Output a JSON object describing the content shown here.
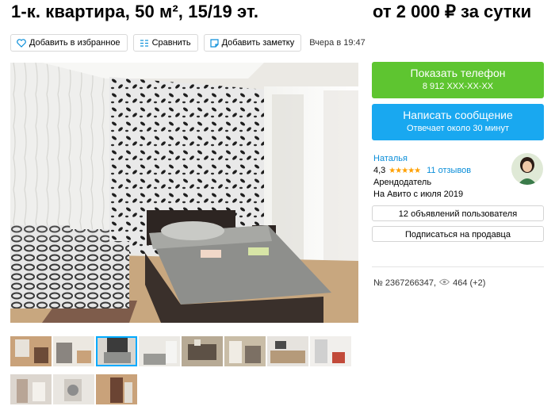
{
  "listing": {
    "title": "1-к. квартира, 50 м², 15/19 эт.",
    "price": "от 2 000 ₽ за сутки"
  },
  "actions": {
    "favorite": "Добавить в избранное",
    "compare": "Сравнить",
    "note": "Добавить заметку",
    "posted": "Вчера в 19:47"
  },
  "contact": {
    "phone_label": "Показать телефон",
    "phone_number": "8 912 XXX-XX-XX",
    "message_label": "Написать сообщение",
    "message_sub": "Отвечает около 30 минут"
  },
  "seller": {
    "name": "Наталья",
    "rating": "4,3",
    "rating_value": 4.3,
    "stars": "★★★★★",
    "reviews": "11 отзывов",
    "role": "Арендодатель",
    "since": "На Авито с июля 2019",
    "listings_button": "12 объявлений пользователя",
    "subscribe_button": "Подписаться на продавца"
  },
  "meta": {
    "id": "№ 2367266347,",
    "views": "464 (+2)"
  },
  "colors": {
    "green": "#5ec530",
    "blue": "#19a8f0",
    "link": "#0a8ed9",
    "star": "#ffa000"
  },
  "thumbnails": {
    "count": 11,
    "selected_index": 2
  }
}
